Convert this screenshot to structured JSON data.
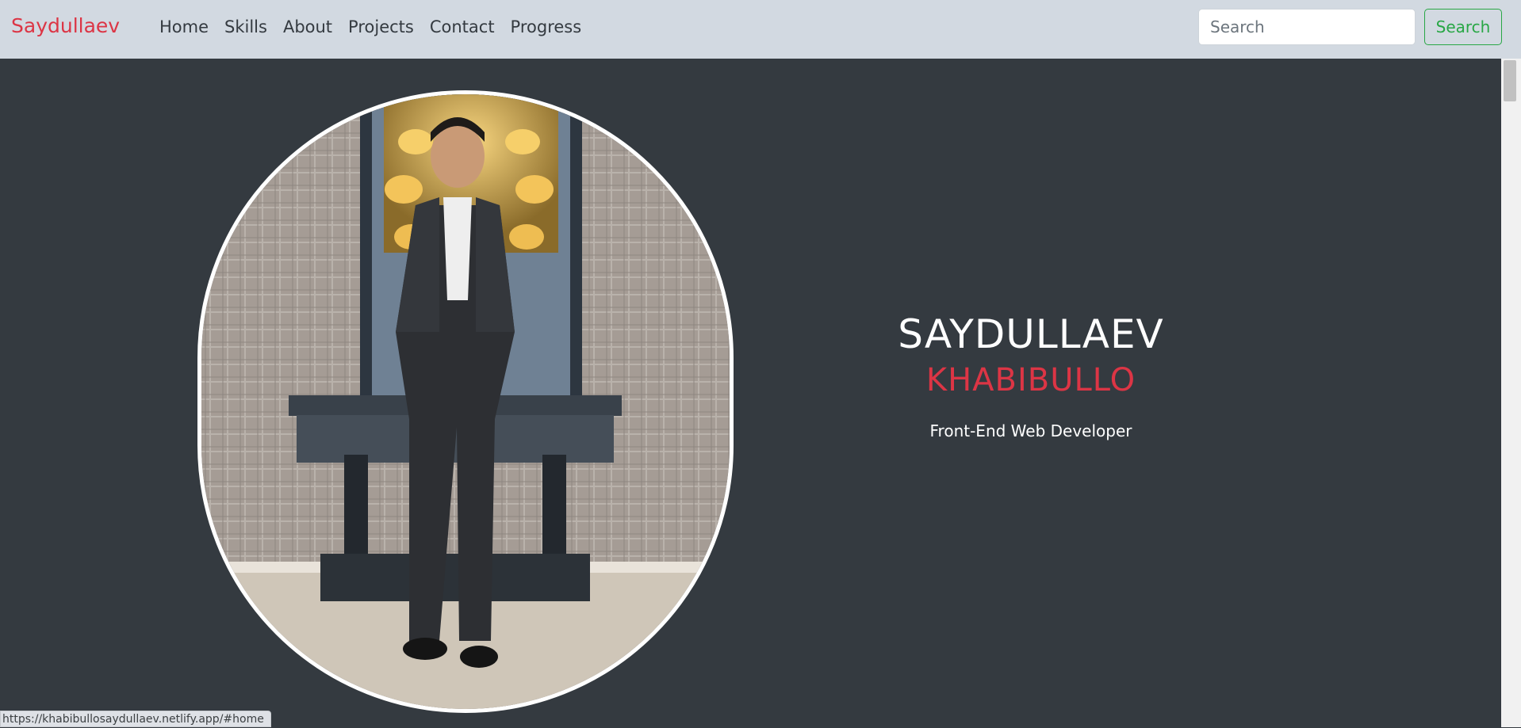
{
  "navbar": {
    "brand": "Saydullaev",
    "links": [
      "Home",
      "Skills",
      "About",
      "Projects",
      "Contact",
      "Progress"
    ],
    "search_placeholder": "Search",
    "search_button": "Search"
  },
  "hero": {
    "first_name": "SAYDULLAEV",
    "last_name": "KHABIBULLO",
    "role": "Front-End Web Developer",
    "portrait_alt": "portrait photo"
  },
  "status_bar": {
    "url": "https://khabibullosaydullaev.netlify.app/#home"
  },
  "colors": {
    "navbar_bg": "#d2d9e1",
    "brand": "#dc3545",
    "page_bg": "#343a40",
    "accent_green": "#28a745"
  }
}
